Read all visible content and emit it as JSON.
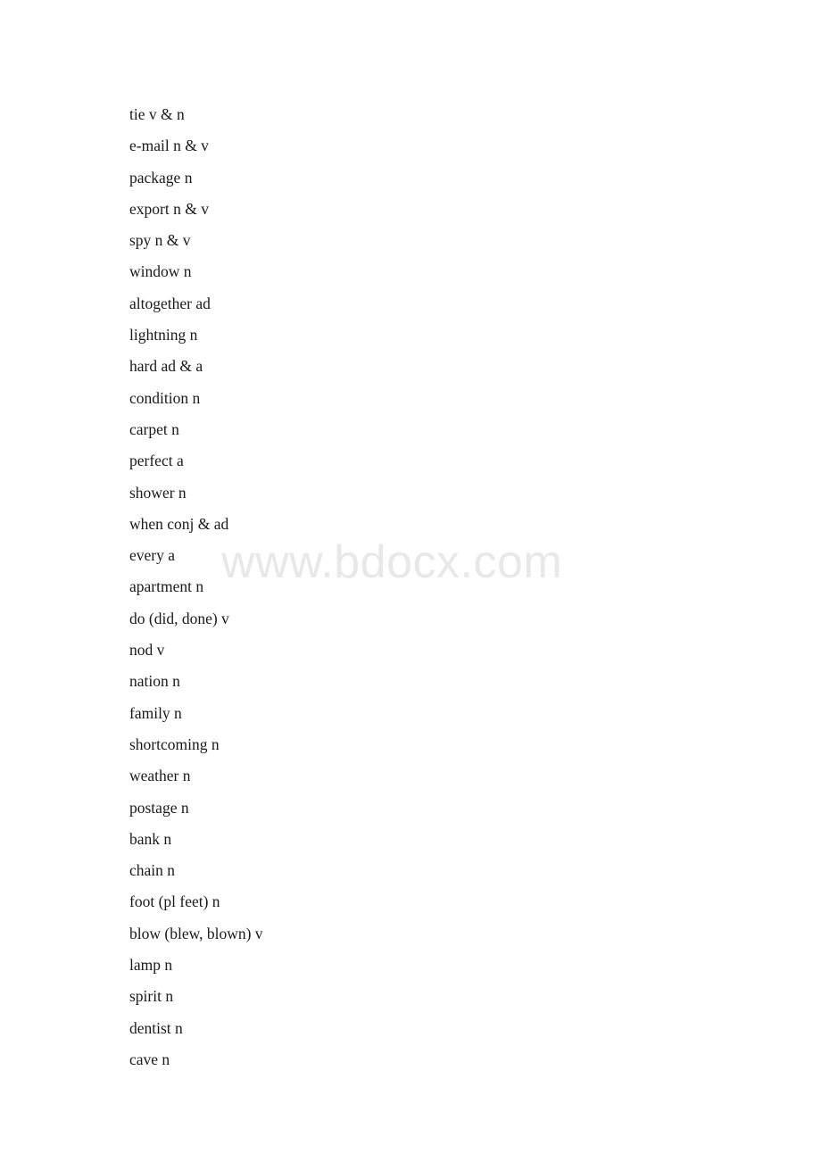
{
  "document": {
    "type": "vocabulary-word-list",
    "page_background": "#ffffff",
    "text_color": "#1a1a1a"
  },
  "watermark": {
    "text": "www.bdocx.com",
    "color": "#e8e8e8"
  },
  "word_list": {
    "entries": [
      {
        "text": "tie v & n"
      },
      {
        "text": "e-mail n & v"
      },
      {
        "text": "package n"
      },
      {
        "text": "export n & v"
      },
      {
        "text": "spy n & v"
      },
      {
        "text": "window n"
      },
      {
        "text": "altogether ad"
      },
      {
        "text": "lightning n"
      },
      {
        "text": "hard ad & a"
      },
      {
        "text": "condition n"
      },
      {
        "text": "carpet n"
      },
      {
        "text": "perfect a"
      },
      {
        "text": "shower n"
      },
      {
        "text": "when conj & ad"
      },
      {
        "text": "every a"
      },
      {
        "text": "apartment n"
      },
      {
        "text": "do (did, done) v"
      },
      {
        "text": "nod v"
      },
      {
        "text": "nation n"
      },
      {
        "text": "family n"
      },
      {
        "text": "shortcoming n"
      },
      {
        "text": "weather n"
      },
      {
        "text": "postage n"
      },
      {
        "text": "bank n"
      },
      {
        "text": "chain n"
      },
      {
        "text": "foot (pl feet) n"
      },
      {
        "text": "blow (blew, blown) v"
      },
      {
        "text": "lamp n"
      },
      {
        "text": "spirit n"
      },
      {
        "text": "dentist n"
      },
      {
        "text": "cave n"
      }
    ]
  }
}
